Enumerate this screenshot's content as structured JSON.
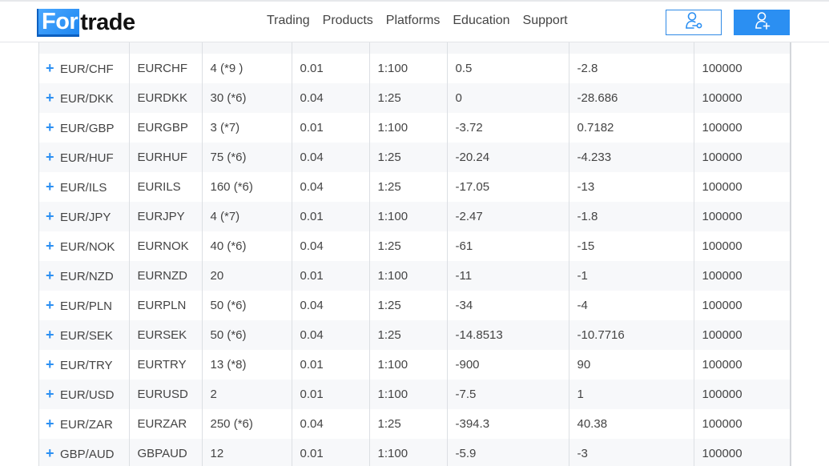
{
  "header": {
    "logo": {
      "highlight": "For",
      "rest": "trade"
    },
    "nav": [
      "Trading",
      "Products",
      "Platforms",
      "Education",
      "Support"
    ],
    "buttons": {
      "login_icon": "user-key-icon",
      "register_icon": "user-plus-icon"
    },
    "colors": {
      "accent": "#2b8ff2",
      "text": "#444444"
    }
  },
  "table": {
    "expand_icon": "+",
    "rows": [
      {
        "instrument": "EUR/CHF",
        "symbol": "EURCHF",
        "spread": "4 (*9 )",
        "margin": "0.01",
        "leverage": "1:100",
        "swap_long": "0.5",
        "swap_short": "-2.8",
        "contract_size": "100000"
      },
      {
        "instrument": "EUR/DKK",
        "symbol": "EURDKK",
        "spread": "30 (*6)",
        "margin": "0.04",
        "leverage": "1:25",
        "swap_long": "0",
        "swap_short": "-28.686",
        "contract_size": "100000"
      },
      {
        "instrument": "EUR/GBP",
        "symbol": "EURGBP",
        "spread": "3 (*7)",
        "margin": "0.01",
        "leverage": "1:100",
        "swap_long": "-3.72",
        "swap_short": "0.7182",
        "contract_size": "100000"
      },
      {
        "instrument": "EUR/HUF",
        "symbol": "EURHUF",
        "spread": "75 (*6)",
        "margin": "0.04",
        "leverage": "1:25",
        "swap_long": "-20.24",
        "swap_short": "-4.233",
        "contract_size": "100000"
      },
      {
        "instrument": "EUR/ILS",
        "symbol": "EURILS",
        "spread": "160 (*6)",
        "margin": "0.04",
        "leverage": "1:25",
        "swap_long": "-17.05",
        "swap_short": "-13",
        "contract_size": "100000"
      },
      {
        "instrument": "EUR/JPY",
        "symbol": "EURJPY",
        "spread": "4 (*7)",
        "margin": "0.01",
        "leverage": "1:100",
        "swap_long": "-2.47",
        "swap_short": "-1.8",
        "contract_size": "100000"
      },
      {
        "instrument": "EUR/NOK",
        "symbol": "EURNOK",
        "spread": "40 (*6)",
        "margin": "0.04",
        "leverage": "1:25",
        "swap_long": "-61",
        "swap_short": "-15",
        "contract_size": "100000"
      },
      {
        "instrument": "EUR/NZD",
        "symbol": "EURNZD",
        "spread": "20",
        "margin": "0.01",
        "leverage": "1:100",
        "swap_long": "-11",
        "swap_short": "-1",
        "contract_size": "100000"
      },
      {
        "instrument": "EUR/PLN",
        "symbol": "EURPLN",
        "spread": "50 (*6)",
        "margin": "0.04",
        "leverage": "1:25",
        "swap_long": "-34",
        "swap_short": "-4",
        "contract_size": "100000"
      },
      {
        "instrument": "EUR/SEK",
        "symbol": "EURSEK",
        "spread": "50 (*6)",
        "margin": "0.04",
        "leverage": "1:25",
        "swap_long": "-14.8513",
        "swap_short": "-10.7716",
        "contract_size": "100000"
      },
      {
        "instrument": "EUR/TRY",
        "symbol": "EURTRY",
        "spread": "13 (*8)",
        "margin": "0.01",
        "leverage": "1:100",
        "swap_long": "-900",
        "swap_short": "90",
        "contract_size": "100000"
      },
      {
        "instrument": "EUR/USD",
        "symbol": "EURUSD",
        "spread": "2",
        "margin": "0.01",
        "leverage": "1:100",
        "swap_long": "-7.5",
        "swap_short": "1",
        "contract_size": "100000"
      },
      {
        "instrument": "EUR/ZAR",
        "symbol": "EURZAR",
        "spread": "250 (*6)",
        "margin": "0.04",
        "leverage": "1:25",
        "swap_long": "-394.3",
        "swap_short": "40.38",
        "contract_size": "100000"
      },
      {
        "instrument": "GBP/AUD",
        "symbol": "GBPAUD",
        "spread": "12",
        "margin": "0.01",
        "leverage": "1:100",
        "swap_long": "-5.9",
        "swap_short": "-3",
        "contract_size": "100000"
      }
    ]
  }
}
